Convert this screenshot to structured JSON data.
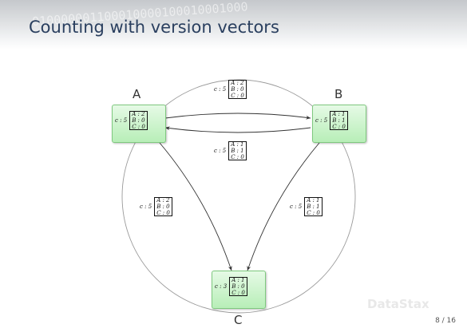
{
  "slide": {
    "title": "Counting with version vectors",
    "page_number": "8 / 16",
    "watermark": "DataStax",
    "header_digits": "010000001100010000100010001000"
  },
  "nodes": {
    "A": {
      "label": "A",
      "count": "c : 5",
      "vector": [
        "A : 2",
        "B : 0",
        "C : 0"
      ]
    },
    "B": {
      "label": "B",
      "count": "c : 5",
      "vector": [
        "A : 1",
        "B : 1",
        "C : 0"
      ]
    },
    "C": {
      "label": "C",
      "count": "c : 3",
      "vector": [
        "A : 1",
        "B : 0",
        "C : 0"
      ]
    }
  },
  "edges": {
    "a_to_b": {
      "count": "c : 5",
      "vector": [
        "A : 2",
        "B : 0",
        "C : 0"
      ]
    },
    "b_to_a": {
      "count": "c : 5",
      "vector": [
        "A : 1",
        "B : 1",
        "C : 0"
      ]
    },
    "a_to_c": {
      "count": "c : 5",
      "vector": [
        "A : 2",
        "B : 0",
        "C : 0"
      ]
    },
    "b_to_c": {
      "count": "c : 5",
      "vector": [
        "A : 1",
        "B : 1",
        "C : 0"
      ]
    }
  },
  "colors": {
    "title": "#2a3f5f",
    "node_fill": "#c9f2c9",
    "node_border": "#7fc97f",
    "edge": "#333333",
    "ring": "#9a9a9a"
  }
}
